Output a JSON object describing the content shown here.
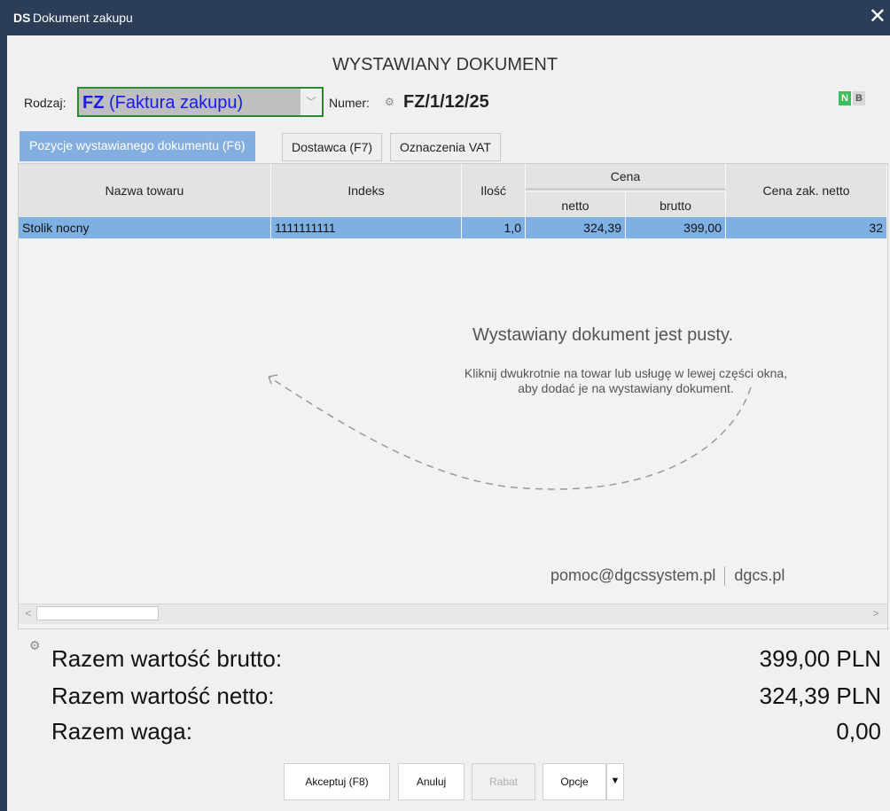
{
  "window": {
    "logo": "DS",
    "title": "Dokument zakupu",
    "close": "✕"
  },
  "heading": "WYSTAWIANY DOKUMENT",
  "rodzaj": {
    "label": "Rodzaj:",
    "code": "FZ",
    "name": "(Faktura zakupu)"
  },
  "numer": {
    "label": "Numer:",
    "value": "FZ/1/12/25"
  },
  "badges": {
    "n": "N",
    "b": "B"
  },
  "tabs": [
    {
      "label": "Pozycje wystawianego dokumentu (F6)",
      "active": true
    },
    {
      "label": "Dostawca (F7)",
      "active": false
    },
    {
      "label": "Oznaczenia VAT",
      "active": false
    }
  ],
  "table": {
    "headers": {
      "nazwa": "Nazwa towaru",
      "indeks": "Indeks",
      "ilosc": "Ilość",
      "cena": "Cena",
      "netto": "netto",
      "brutto": "brutto",
      "cena_zak": "Cena zak. netto"
    },
    "row": {
      "nazwa": "Stolik nocny",
      "indeks": "1111111111",
      "ilosc": "1,0",
      "netto": "324,39",
      "brutto": "399,00",
      "cena_zak": "32"
    }
  },
  "empty": {
    "title": "Wystawiany dokument jest pusty.",
    "hint1": "Kliknij dwukrotnie na towar lub usługę w lewej części okna,",
    "hint2": "aby dodać je na wystawiany dokument."
  },
  "help": {
    "email": "pomoc@dgcssystem.pl",
    "site": "dgcs.pl"
  },
  "totals": {
    "brutto_label": "Razem wartość brutto:",
    "brutto_value": "399,00 PLN",
    "netto_label": "Razem wartość netto:",
    "netto_value": "324,39 PLN",
    "waga_label": "Razem waga:",
    "waga_value": "0,00"
  },
  "buttons": {
    "akceptuj": "Akceptuj (F8)",
    "anuluj": "Anuluj",
    "rabat": "Rabat",
    "opcje": "Opcje"
  }
}
